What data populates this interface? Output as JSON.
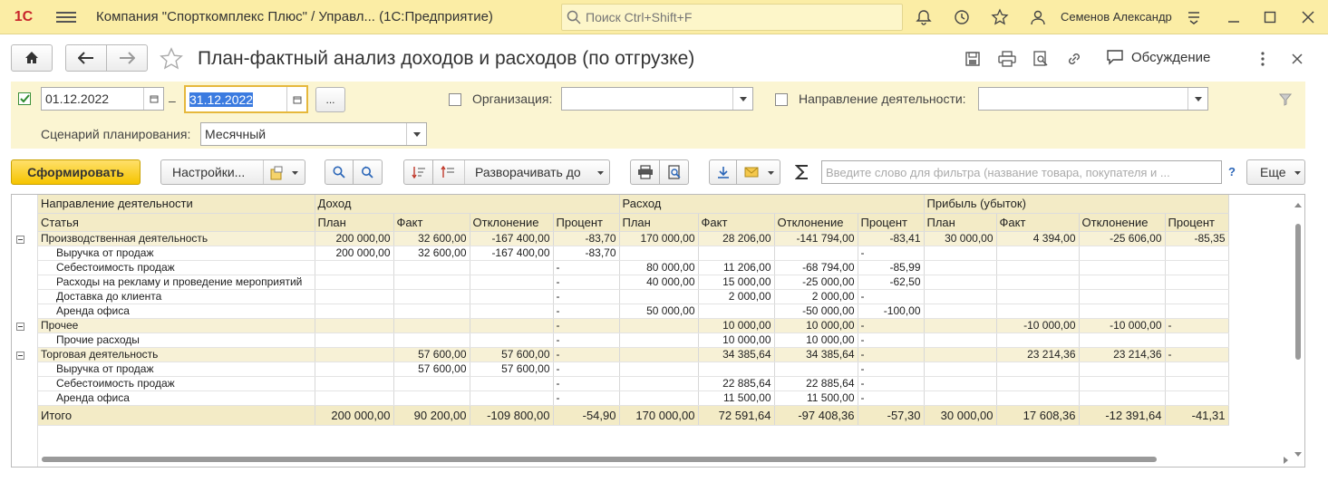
{
  "titlebar": {
    "logo": "1С",
    "app_title": "Компания \"Спорткомплекс Плюс\" / Управл...   (1С:Предприятие)",
    "search_placeholder": "Поиск Ctrl+Shift+F",
    "user": "Семенов Александр"
  },
  "page": {
    "title": "План-фактный анализ доходов и расходов (по отгрузке)",
    "discuss": "Обсуждение"
  },
  "filters": {
    "date_from": "01.12.2022",
    "dash": "–",
    "date_to": "31.12.2022",
    "more": "...",
    "org_label": "Организация:",
    "direction_label": "Направление деятельности:",
    "scenario_label": "Сценарий планирования:",
    "scenario_value": "Месячный"
  },
  "toolbar": {
    "generate": "Сформировать",
    "settings": "Настройки...",
    "expand": "Разворачивать до",
    "filter_placeholder": "Введите слово для фильтра (название товара, покупателя и ...",
    "help": "?",
    "more": "Еще"
  },
  "report": {
    "header1": [
      "Направление деятельности",
      "Доход",
      "Расход",
      "Прибыль (убыток)"
    ],
    "header2": [
      "Статья",
      "План",
      "Факт",
      "Отклонение",
      "Процент",
      "План",
      "Факт",
      "Отклонение",
      "Процент",
      "План",
      "Факт",
      "Отклонение",
      "Процент"
    ],
    "rows": [
      {
        "group": true,
        "cells": [
          "Производственная деятельность",
          "200 000,00",
          "32 600,00",
          "-167 400,00",
          "-83,70",
          "170 000,00",
          "28 206,00",
          "-141 794,00",
          "-83,41",
          "30 000,00",
          "4 394,00",
          "-25 606,00",
          "-85,35"
        ]
      },
      {
        "group": false,
        "cells": [
          "Выручка от продаж",
          "200 000,00",
          "32 600,00",
          "-167 400,00",
          "-83,70",
          "",
          "",
          "",
          "-",
          "",
          "",
          "",
          ""
        ]
      },
      {
        "group": false,
        "cells": [
          "Себестоимость продаж",
          "",
          "",
          "",
          "-",
          "80 000,00",
          "11 206,00",
          "-68 794,00",
          "-85,99",
          "",
          "",
          "",
          ""
        ]
      },
      {
        "group": false,
        "cells": [
          "Расходы на рекламу и проведение мероприятий",
          "",
          "",
          "",
          "-",
          "40 000,00",
          "15 000,00",
          "-25 000,00",
          "-62,50",
          "",
          "",
          "",
          ""
        ]
      },
      {
        "group": false,
        "cells": [
          "Доставка до клиента",
          "",
          "",
          "",
          "-",
          "",
          "2 000,00",
          "2 000,00",
          "-",
          "",
          "",
          "",
          ""
        ]
      },
      {
        "group": false,
        "cells": [
          "Аренда офиса",
          "",
          "",
          "",
          "-",
          "50 000,00",
          "",
          "-50 000,00",
          "-100,00",
          "",
          "",
          "",
          ""
        ]
      },
      {
        "group": true,
        "cells": [
          "Прочее",
          "",
          "",
          "",
          "-",
          "",
          "10 000,00",
          "10 000,00",
          "-",
          "",
          "-10 000,00",
          "-10 000,00",
          "-"
        ]
      },
      {
        "group": false,
        "cells": [
          "Прочие расходы",
          "",
          "",
          "",
          "-",
          "",
          "10 000,00",
          "10 000,00",
          "-",
          "",
          "",
          "",
          ""
        ]
      },
      {
        "group": true,
        "cells": [
          "Торговая деятельность",
          "",
          "57 600,00",
          "57 600,00",
          "-",
          "",
          "34 385,64",
          "34 385,64",
          "-",
          "",
          "23 214,36",
          "23 214,36",
          "-"
        ]
      },
      {
        "group": false,
        "cells": [
          "Выручка от продаж",
          "",
          "57 600,00",
          "57 600,00",
          "-",
          "",
          "",
          "",
          "-",
          "",
          "",
          "",
          ""
        ]
      },
      {
        "group": false,
        "cells": [
          "Себестоимость продаж",
          "",
          "",
          "",
          "-",
          "",
          "22 885,64",
          "22 885,64",
          "-",
          "",
          "",
          "",
          ""
        ]
      },
      {
        "group": false,
        "cells": [
          "Аренда офиса",
          "",
          "",
          "",
          "-",
          "",
          "11 500,00",
          "11 500,00",
          "-",
          "",
          "",
          "",
          ""
        ]
      }
    ],
    "total": [
      "Итого",
      "200 000,00",
      "90 200,00",
      "-109 800,00",
      "-54,90",
      "170 000,00",
      "72 591,64",
      "-97 408,36",
      "-57,30",
      "30 000,00",
      "17 608,36",
      "-12 391,64",
      "-41,31"
    ]
  },
  "colors": {
    "accent": "#f5c400",
    "titlebar": "#fbeda5",
    "panel": "#fbf5d2",
    "header": "#f3ebc6"
  }
}
